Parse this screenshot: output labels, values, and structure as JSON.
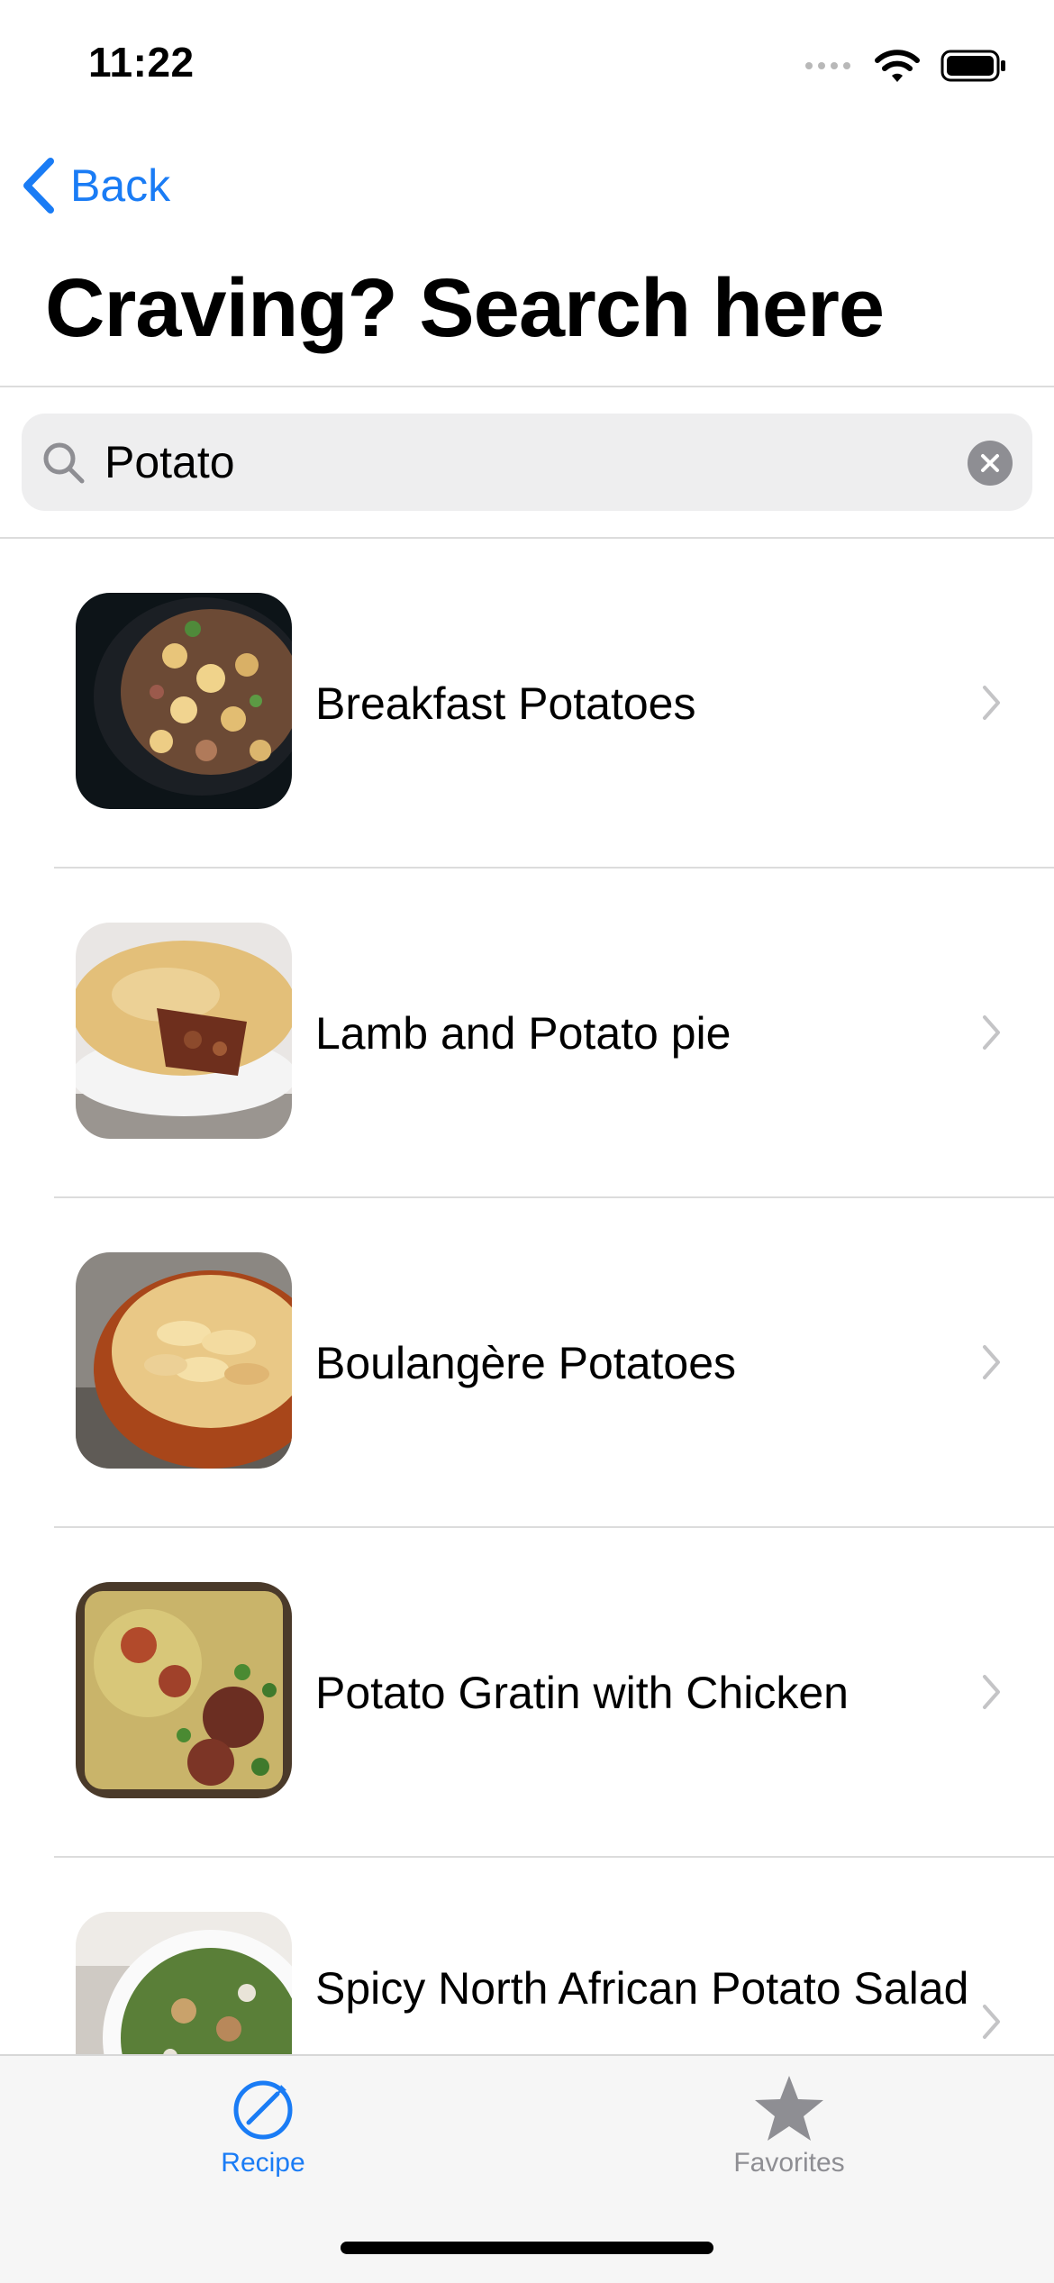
{
  "status_bar": {
    "time": "11:22"
  },
  "nav": {
    "back_label": "Back"
  },
  "header": {
    "title": "Craving? Search here"
  },
  "search": {
    "value": "Potato"
  },
  "results": [
    {
      "title": "Breakfast Potatoes",
      "thumbnail": "breakfast-potatoes-image"
    },
    {
      "title": "Lamb and Potato pie",
      "thumbnail": "lamb-potato-pie-image"
    },
    {
      "title": "Boulangère Potatoes",
      "thumbnail": "boulangere-potatoes-image"
    },
    {
      "title": "Potato Gratin with Chicken",
      "thumbnail": "potato-gratin-chicken-image"
    },
    {
      "title": "Spicy North African Potato Salad",
      "thumbnail": "potato-salad-image"
    }
  ],
  "tab_bar": {
    "tabs": [
      {
        "label": "Recipe",
        "icon": "compass-icon",
        "active": true
      },
      {
        "label": "Favorites",
        "icon": "star-icon",
        "active": false
      }
    ]
  },
  "colors": {
    "accent": "#1a7cf5",
    "inactive_tab": "#8e8e93",
    "chevron": "#c4c4c6"
  }
}
